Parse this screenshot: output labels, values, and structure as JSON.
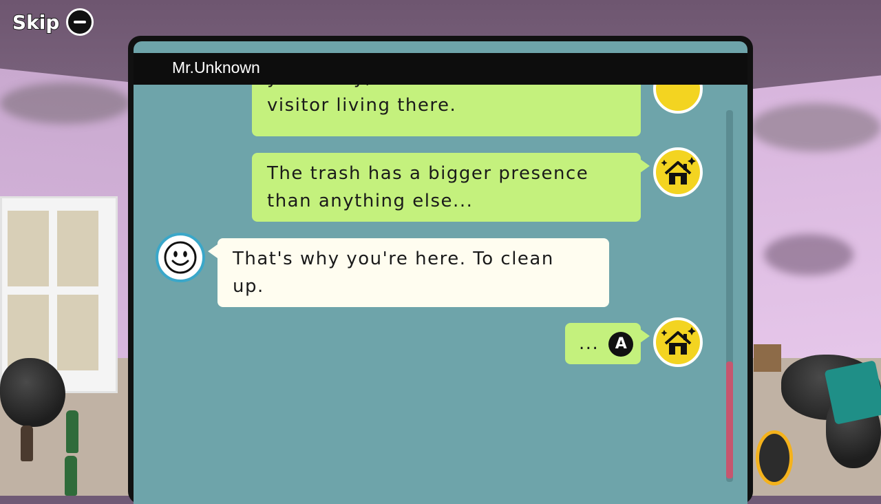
{
  "skip": {
    "label": "Skip",
    "button_icon": "minus-button-icon"
  },
  "chat": {
    "speaker": "Mr.Unknown",
    "messages": [
      {
        "sender": "player",
        "avatar": "house-sparkle-icon",
        "lines": [
          "yesterday, with the unwanted",
          "visitor living there."
        ]
      },
      {
        "sender": "player",
        "avatar": "house-sparkle-icon",
        "lines": [
          "The trash has a bigger presence",
          "than anything else..."
        ]
      },
      {
        "sender": "mr-unknown",
        "avatar": "smiley-face-icon",
        "lines": [
          "That's why you're here. To clean",
          "up."
        ]
      },
      {
        "sender": "player",
        "avatar": "house-sparkle-icon",
        "lines": [
          "..."
        ],
        "button": "A"
      }
    ]
  },
  "colors": {
    "player_bubble": "#c4f17d",
    "other_bubble": "#fffdf0",
    "panel_bg": "#6ea4aa",
    "avatar_player": "#f3d421",
    "avatar_other_ring": "#3aa7c9",
    "scroll_thumb": "#c6566f"
  }
}
